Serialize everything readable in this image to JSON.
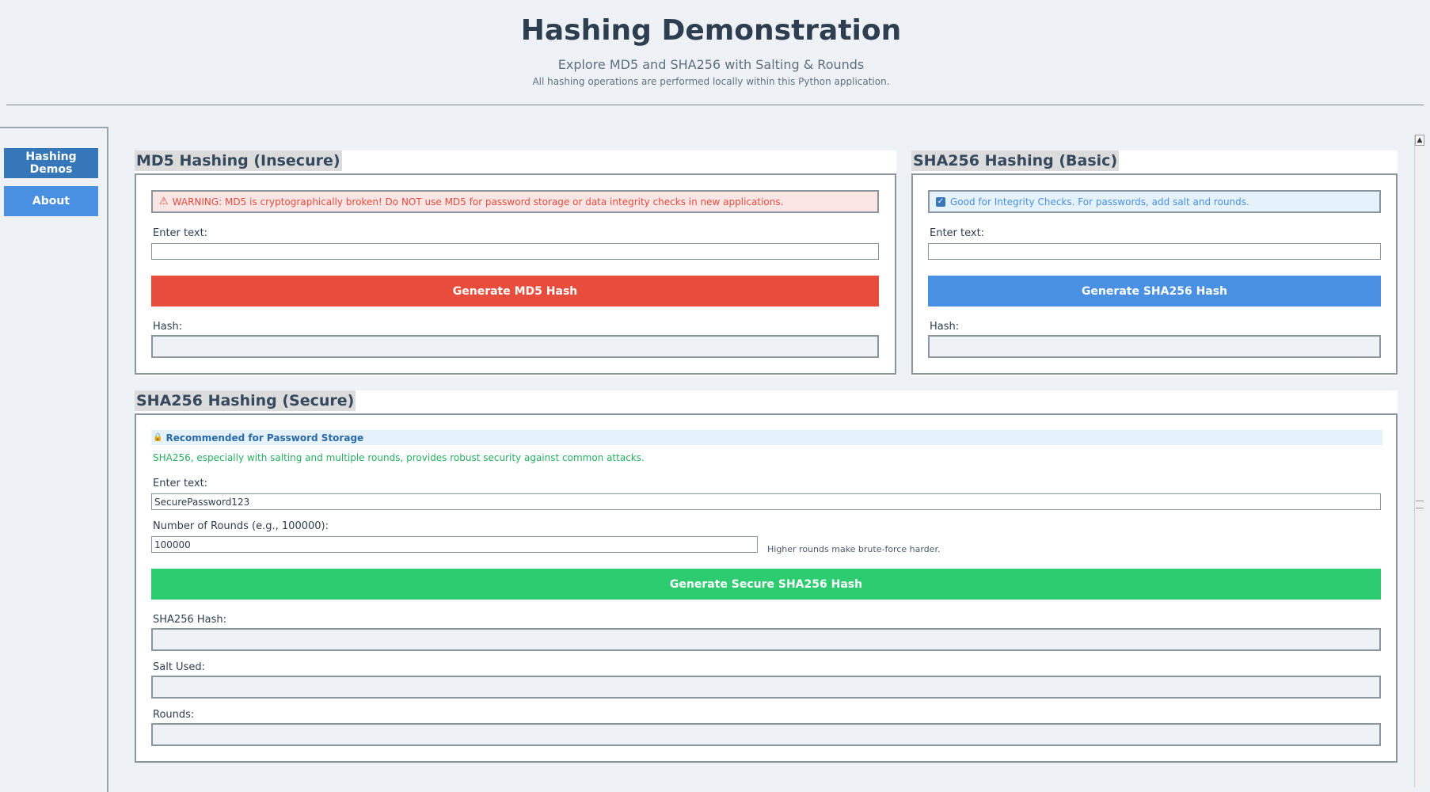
{
  "header": {
    "title": "Hashing Demonstration",
    "subtitle": "Explore MD5 and SHA256 with Salting & Rounds",
    "note": "All hashing operations are performed locally within this Python application."
  },
  "sidebar": {
    "items": [
      {
        "label": "Hashing Demos",
        "active": true
      },
      {
        "label": "About",
        "active": false
      }
    ]
  },
  "md5": {
    "title": "MD5 Hashing (Insecure)",
    "warning": "WARNING: MD5 is cryptographically broken! Do NOT use MD5 for password storage or data integrity checks in new applications.",
    "input_label": "Enter text:",
    "input_value": "",
    "button_label": "Generate MD5 Hash",
    "hash_label": "Hash:",
    "hash_value": ""
  },
  "sha_basic": {
    "title": "SHA256 Hashing (Basic)",
    "info": "Good for Integrity Checks. For passwords, add salt and rounds.",
    "input_label": "Enter text:",
    "input_value": "",
    "button_label": "Generate SHA256 Hash",
    "hash_label": "Hash:",
    "hash_value": ""
  },
  "sha_secure": {
    "title": "SHA256 Hashing (Secure)",
    "recommend": "Recommended for Password Storage",
    "description": "SHA256, especially with salting and multiple rounds, provides robust security against common attacks.",
    "input_label": "Enter text:",
    "input_value": "SecurePassword123",
    "rounds_label": "Number of Rounds (e.g., 100000):",
    "rounds_value": "100000",
    "rounds_hint": "Higher rounds make brute-force harder.",
    "button_label": "Generate Secure SHA256 Hash",
    "hash_label": "SHA256 Hash:",
    "hash_value": "",
    "salt_label": "Salt Used:",
    "salt_value": "",
    "rounds_out_label": "Rounds:",
    "rounds_out_value": ""
  },
  "colors": {
    "md5_button": "#e74c3c",
    "sha_button": "#4a90e2",
    "secure_button": "#2ecc71",
    "nav_active": "#3577b8",
    "nav": "#4a90e2"
  },
  "icons": {
    "warning": "warning-triangle-icon",
    "check": "checkbox-check-icon",
    "lock": "lock-icon",
    "scroll_up": "scroll-up-arrow-icon"
  }
}
